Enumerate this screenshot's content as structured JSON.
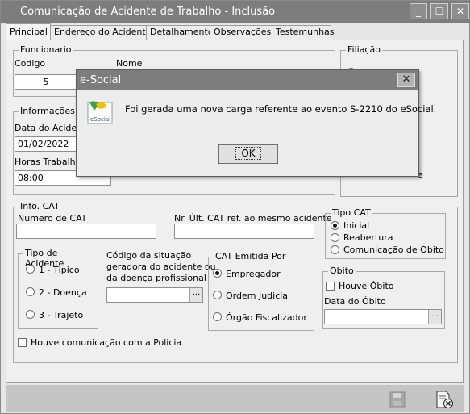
{
  "window": {
    "title": "Comunicação de Acidente de Trabalho - Inclusão",
    "controls": {
      "minimize": "_",
      "maximize": "☐",
      "close": "✕"
    }
  },
  "tabs": [
    "Principal",
    "Endereço do Acidente",
    "Detalhamento",
    "Observações",
    "Testemunhas"
  ],
  "funcionario": {
    "group_label": "Funcionario",
    "codigo_label": "Codigo",
    "codigo_value": "5",
    "nome_label": "Nome"
  },
  "filiacao": {
    "group_label": "Filiação",
    "partial_text": "e"
  },
  "informacoes": {
    "group_label": "Informações do",
    "data_label": "Data do Acident",
    "data_value": "01/02/2022",
    "horas_label": "Horas Trabalhad",
    "horas_value": "08:00"
  },
  "info_cat": {
    "group_label": "Info. CAT",
    "numero_label": "Numero de CAT",
    "numero_value": "",
    "nr_ult_label": "Nr. Últ. CAT ref. ao mesmo acidente",
    "nr_ult_value": ""
  },
  "tipo_cat": {
    "group_label": "Tipo CAT",
    "options": [
      "Inicial",
      "Reabertura",
      "Comunicação de Obito"
    ],
    "selected": "Inicial"
  },
  "tipo_acidente": {
    "group_label": "Tipo de Acidente",
    "options": [
      "1 - Típico",
      "2 - Doença",
      "3 - Trajeto"
    ]
  },
  "codigo_situacao": {
    "label_line1": "Código da situação",
    "label_line2": "geradora do acidente ou",
    "label_line3": "da doença profissional",
    "value": ""
  },
  "cat_emitida": {
    "group_label": "CAT Emitida Por",
    "options": [
      "Empregador",
      "Ordem Judicial",
      "Órgão Fiscalizador"
    ],
    "selected": "Empregador"
  },
  "obito": {
    "group_label": "Óbito",
    "houve_label": "Houve Óbito",
    "data_label": "Data do Óbito",
    "data_value": ""
  },
  "policia": {
    "label": "Houve comunicação com a Policia"
  },
  "ellipsis": "...",
  "dialog": {
    "title": "e-Social",
    "message": "Foi gerada uma nova carga referente ao evento S-2210 do eSocial.",
    "ok_label": "OK",
    "close": "✕",
    "logo_text": "eSocial"
  }
}
